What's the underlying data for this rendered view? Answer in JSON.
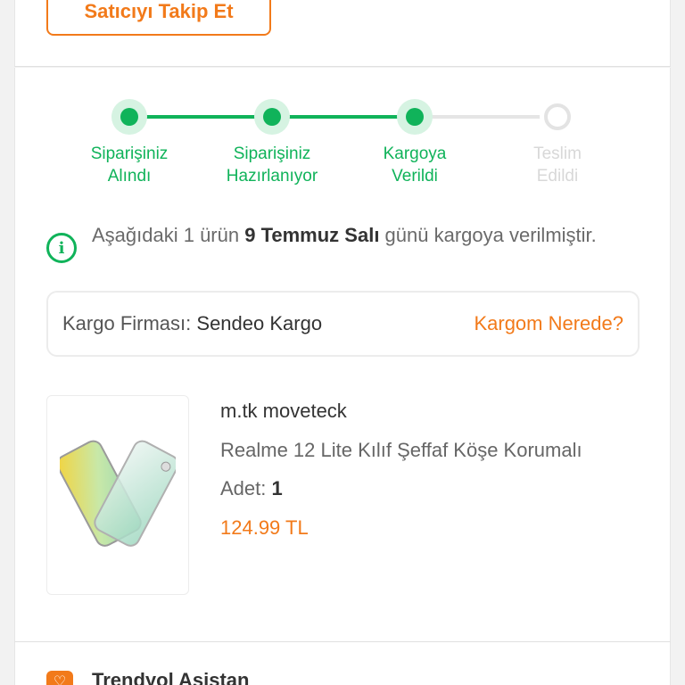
{
  "header": {
    "follow_seller_label": "Satıcıyı Takip Et"
  },
  "tracker": {
    "steps": [
      {
        "line1": "Siparişiniz",
        "line2": "Alındı",
        "status": "done"
      },
      {
        "line1": "Siparişiniz",
        "line2": "Hazırlanıyor",
        "status": "done"
      },
      {
        "line1": "Kargoya",
        "line2": "Verildi",
        "status": "done"
      },
      {
        "line1": "Teslim",
        "line2": "Edildi",
        "status": "pending"
      }
    ],
    "active_color": "#10b35a",
    "inactive_color": "#e3e3e3"
  },
  "notice": {
    "icon": "info-icon",
    "prefix": "Aşağıdaki 1 ürün ",
    "date": "9 Temmuz Salı",
    "suffix": " günü kargoya verilmiştir."
  },
  "cargo": {
    "label": "Kargo Firması:",
    "company": "Sendeo Kargo",
    "track_link": "Kargom Nerede?"
  },
  "product": {
    "seller": "m.tk moveteck",
    "title": "Realme 12 Lite Kılıf Şeffaf Köşe Korumalı",
    "qty_label": "Adet:",
    "qty": "1",
    "price": "124.99 TL"
  },
  "assistant": {
    "label": "Trendyol Asistan",
    "icon": "assistant-icon"
  },
  "accent_color": "#f27a1a"
}
